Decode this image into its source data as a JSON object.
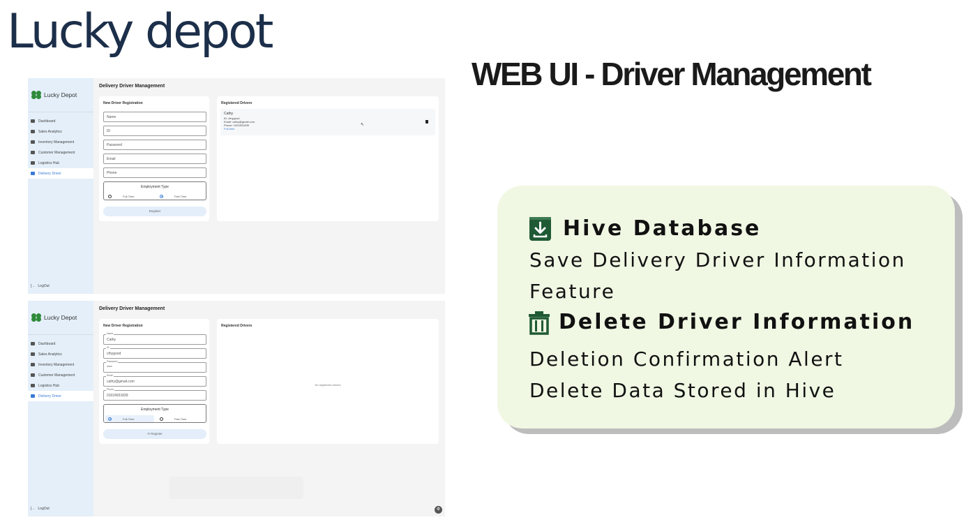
{
  "brand_title": "Lucky depot",
  "slide_heading": "WEB UI - Driver Management",
  "app": {
    "logo": "Lucky Depot",
    "sidebar": [
      {
        "label": "Dashboard",
        "icon": "dashboard-icon"
      },
      {
        "label": "Sales Analytics",
        "icon": "trending-icon"
      },
      {
        "label": "Inventory Management",
        "icon": "inventory-icon"
      },
      {
        "label": "Customer Management",
        "icon": "people-icon"
      },
      {
        "label": "Logistics Hub",
        "icon": "truck-icon"
      },
      {
        "label": "Delivery Driver",
        "icon": "car-icon"
      }
    ],
    "logout": "LogOut",
    "page_title": "Delivery Driver Management",
    "form_title": "New Driver Registration",
    "list_title": "Registered Drivers",
    "placeholders": {
      "name": "Name",
      "id": "ID",
      "password": "Password",
      "email": "Email",
      "phone": "Phone"
    },
    "employment_label": "Employment Type",
    "full_time": "Full-Time",
    "part_time": "Part-Time",
    "register": "Register",
    "register_icon": "⟲ Register",
    "filled": {
      "name": "Cathy",
      "id": "cthygood",
      "password": "****",
      "email": "cathy@gmail.com",
      "phone": "01024931839"
    },
    "driver": {
      "name": "Cathy",
      "id_line": "ID: cthygood",
      "email_line": "Email: cathy@gmail.com",
      "phone_line": "Phone: 1024931839",
      "type": "Full-time"
    },
    "empty_message": "No registered drivers"
  },
  "features": {
    "save_title": "Hive Database",
    "save_desc_1": "Save Delivery Driver Information",
    "save_desc_2": "Feature",
    "delete_title": "Delete Driver Information",
    "delete_desc_1": "Deletion Confirmation Alert",
    "delete_desc_2": "Delete Data Stored in Hive"
  },
  "colors": {
    "brand": "#1c2f4a",
    "card_bg": "#f0f7e3",
    "icon_green": "#1f5a35",
    "sidebar": "#e4eff9",
    "accent": "#3a7bd5"
  }
}
